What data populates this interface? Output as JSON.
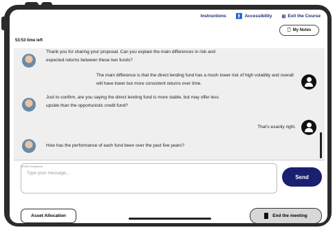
{
  "topbar": {
    "instructions": "Instructions",
    "accessibility": "Accessibility",
    "exit": "Exit the Course"
  },
  "notes": {
    "label": "My Notes"
  },
  "timer": {
    "text": "53:53 time left"
  },
  "messages": [
    {
      "role": "user",
      "text": "Thank you for sharing your proposal. Can you explain the main differences in risk and expected returns between these two funds?"
    },
    {
      "role": "advisor",
      "text": "The main difference is that the direct lending fund has a much lower risk of high volatility and overall will have lower but more consistent returns over time."
    },
    {
      "role": "user",
      "text": "Just to confirm, are you saying the direct lending fund is more stable, but may offer less upside than the opportunistic credit fund?"
    },
    {
      "role": "advisor",
      "text": "That's exactly right."
    },
    {
      "role": "user",
      "text": "How has the performance of each fund been over the past five years?"
    }
  ],
  "composer": {
    "char_count": "0/1000 characters",
    "placeholder": "Type your message...",
    "send_label": "Send"
  },
  "footer": {
    "asset_label": "Asset Allocation",
    "end_label": "End the meeting"
  },
  "colors": {
    "accent": "#1a2070",
    "chat_bg": "#efefef"
  }
}
